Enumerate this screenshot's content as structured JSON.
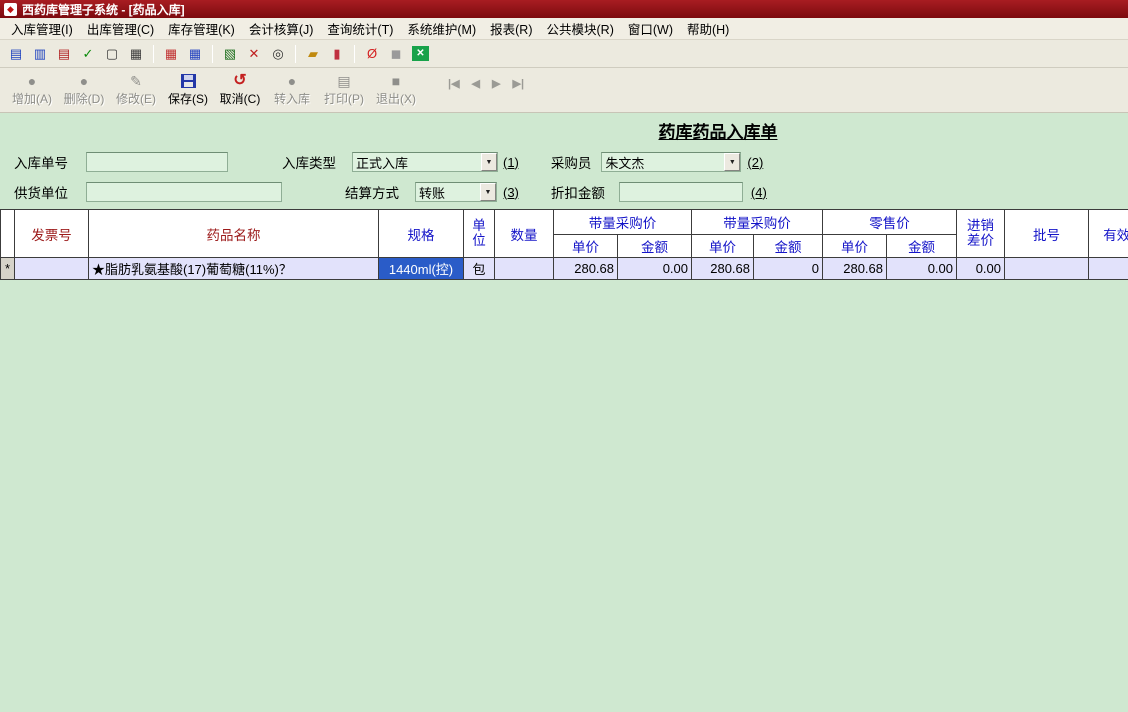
{
  "window": {
    "title": "西药库管理子系统 - [药品入库]",
    "icon_glyph": "◆"
  },
  "colors": {
    "titlebar": "#8c1014",
    "background": "#cfe8d0",
    "field_bg": "#def2df",
    "row_bg": "#e2e2fb",
    "selection": "#2a5cc8",
    "header_red": "#9c1a1a",
    "header_blue": "#1414c8"
  },
  "menu": {
    "items": [
      "入库管理(I)",
      "出库管理(C)",
      "库存管理(K)",
      "会计核算(J)",
      "查询统计(T)",
      "系统维护(M)",
      "报表(R)",
      "公共模块(R)",
      "窗口(W)",
      "帮助(H)"
    ]
  },
  "toolbar": {
    "icons": [
      {
        "name": "new-doc-icon",
        "glyph": "▤",
        "color": "#1a3fbf"
      },
      {
        "name": "save-doc-icon",
        "glyph": "▥",
        "color": "#1a3fbf"
      },
      {
        "name": "edit-doc-icon",
        "glyph": "▤",
        "color": "#b02020"
      },
      {
        "name": "audit-check-icon",
        "glyph": "✓",
        "color": "#0a8a0a"
      },
      {
        "name": "copy-doc-icon",
        "glyph": "▢",
        "color": "#3a3a3a"
      },
      {
        "name": "report-doc-icon",
        "glyph": "▦",
        "color": "#3a3a3a"
      },
      {
        "name": "cards-icon",
        "glyph": "▦",
        "color": "#c03030"
      },
      {
        "name": "table-icon",
        "glyph": "▦",
        "color": "#2040c0"
      },
      {
        "name": "grid-edit-icon",
        "glyph": "▧",
        "color": "#207020"
      },
      {
        "name": "cancel-x-icon",
        "glyph": "✕",
        "color": "#c02020"
      },
      {
        "name": "search-icon",
        "glyph": "◎",
        "color": "#303030"
      },
      {
        "name": "money-folder-icon",
        "glyph": "▰",
        "color": "#c08a10"
      },
      {
        "name": "thermometer-icon",
        "glyph": "▮",
        "color": "#c03040"
      },
      {
        "name": "forbid-icon",
        "glyph": "Ø",
        "color": "#d42020",
        "bg": ""
      },
      {
        "name": "cube-icon",
        "glyph": "◼",
        "color": "#9a9a9a",
        "bg": ""
      },
      {
        "name": "close-grid-icon",
        "glyph": "✕",
        "color": "#ffffff",
        "bg": "#18a24a"
      }
    ]
  },
  "action_bar": {
    "buttons": [
      {
        "label": "增加(A)",
        "icon": "add-icon",
        "glyph": "●",
        "enabled": false,
        "icon_color": "#8f8f8b"
      },
      {
        "label": "删除(D)",
        "icon": "delete-icon",
        "glyph": "●",
        "enabled": false,
        "icon_color": "#8f8f8b"
      },
      {
        "label": "修改(E)",
        "icon": "edit-icon",
        "glyph": "✎",
        "enabled": false,
        "icon_color": "#8f8f8b"
      },
      {
        "label": "保存(S)",
        "icon": "save-icon",
        "glyph": "▣",
        "enabled": true,
        "icon_color": "#2438a8"
      },
      {
        "label": "取消(C)",
        "icon": "cancel-icon",
        "glyph": "↺",
        "enabled": true,
        "icon_color": "#c42020"
      },
      {
        "label": "转入库",
        "icon": "transfer-icon",
        "glyph": "●",
        "enabled": false,
        "icon_color": "#8f8f8b"
      },
      {
        "label": "打印(P)",
        "icon": "print-icon",
        "glyph": "▤",
        "enabled": false,
        "icon_color": "#8f8f8b"
      },
      {
        "label": "退出(X)",
        "icon": "exit-icon",
        "glyph": "■",
        "enabled": false,
        "icon_color": "#8f8f8b"
      }
    ],
    "nav": [
      "|◀",
      "◀",
      "▶",
      "▶|"
    ]
  },
  "form": {
    "title": "药库药品入库单",
    "stockin_no": {
      "label": "入库单号",
      "value": ""
    },
    "stockin_type": {
      "label": "入库类型",
      "value": "正式入库",
      "hint": "(1)"
    },
    "purchaser": {
      "label": "采购员",
      "value": "朱文杰",
      "hint": "(2)"
    },
    "supplier": {
      "label": "供货单位",
      "value": ""
    },
    "settlement": {
      "label": "结算方式",
      "value": "转账",
      "hint": "(3)"
    },
    "discount": {
      "label": "折扣金额",
      "value": "",
      "hint": "(4)"
    },
    "dropdown_arrow": "▼"
  },
  "grid": {
    "headers": {
      "invoice_no": "发票号",
      "drug_name": "药品名称",
      "spec": "规格",
      "unit_line1": "单",
      "unit_line2": "位",
      "qty": "数量",
      "group1": "带量采购价",
      "group2": "带量采购价",
      "group3": "零售价",
      "unit_price": "单价",
      "amount": "金额",
      "margin_line1": "进销",
      "margin_line2": "差价",
      "batch_no": "批号",
      "expiry": "有效期"
    },
    "row": {
      "marker": "*",
      "invoice_no": "",
      "drug_name": "★脂肪乳氨基酸(17)葡萄糖(11%)？",
      "spec": "1440ml(控)",
      "unit": "包",
      "qty": "",
      "vp1_unit": "280.68",
      "vp1_amount": "0.00",
      "vp2_unit": "280.68",
      "vp2_amount": "0",
      "retail_unit": "280.68",
      "retail_amount": "0.00",
      "margin": "0.00",
      "batch_no": "",
      "expiry": ""
    }
  }
}
